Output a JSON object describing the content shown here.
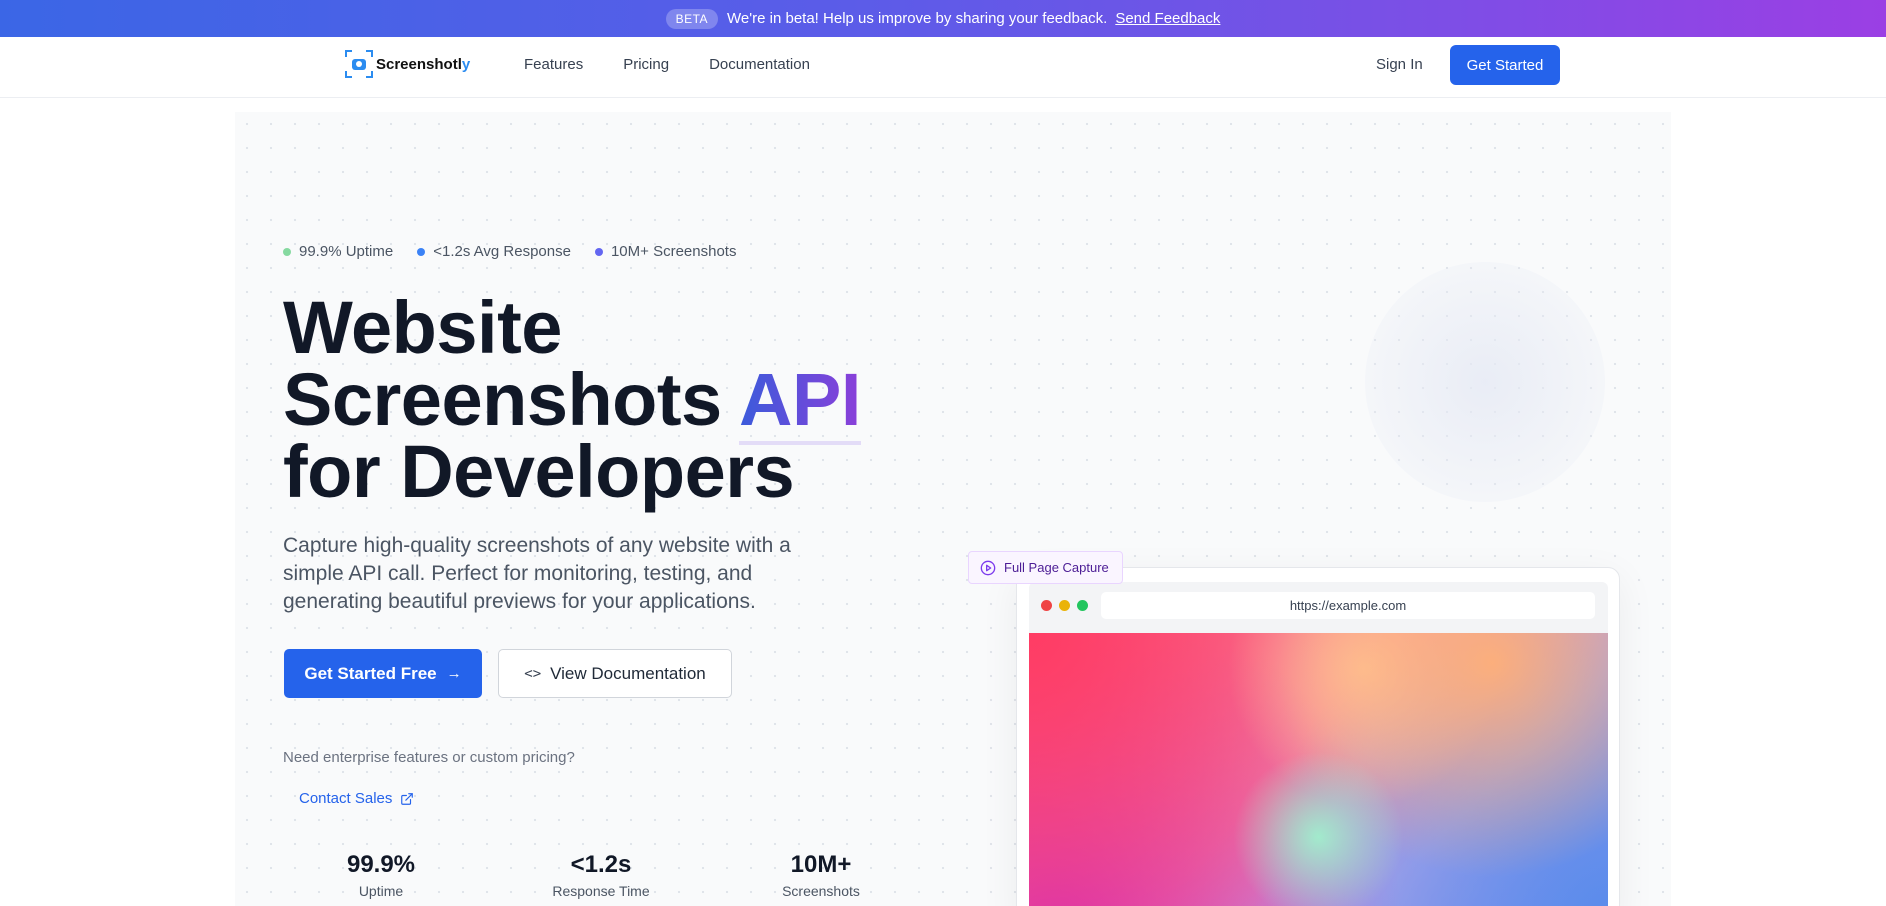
{
  "beta_bar": {
    "badge": "BETA",
    "message": "We're in beta! Help us improve by sharing your feedback.",
    "link": "Send Feedback"
  },
  "nav": {
    "logo_main": "Screenshotl",
    "logo_accent": "y",
    "links": [
      "Features",
      "Pricing",
      "Documentation"
    ],
    "sign_in": "Sign In",
    "get_started": "Get Started"
  },
  "hero": {
    "stats_top": [
      {
        "label": "99.9% Uptime",
        "color": "#86d9a0"
      },
      {
        "label": "<1.2s Avg Response",
        "color": "#3b82f6"
      },
      {
        "label": "10M+ Screenshots",
        "color": "#6366f1"
      }
    ],
    "headline_line1": "Website",
    "headline_line2": "Screenshots",
    "headline_accent": "API",
    "headline_line3": "for Developers",
    "subtitle": "Capture high-quality screenshots of any website with a simple API call. Perfect for monitoring, testing, and generating beautiful previews for your applications.",
    "primary_button": "Get Started Free",
    "secondary_button": "View Documentation",
    "enterprise_text": "Need enterprise features or custom pricing?",
    "contact_link": "Contact Sales",
    "metrics": [
      {
        "value": "99.9%",
        "label": "Uptime"
      },
      {
        "value": "<1.2s",
        "label": "Response Time"
      },
      {
        "value": "10M+",
        "label": "Screenshots"
      }
    ]
  },
  "preview": {
    "badge": "Full Page Capture",
    "url": "https://example.com"
  },
  "colors": {
    "primary": "#2563eb",
    "brand_blue": "#2b8cf0",
    "accent_purple": "#8b3fd9"
  }
}
